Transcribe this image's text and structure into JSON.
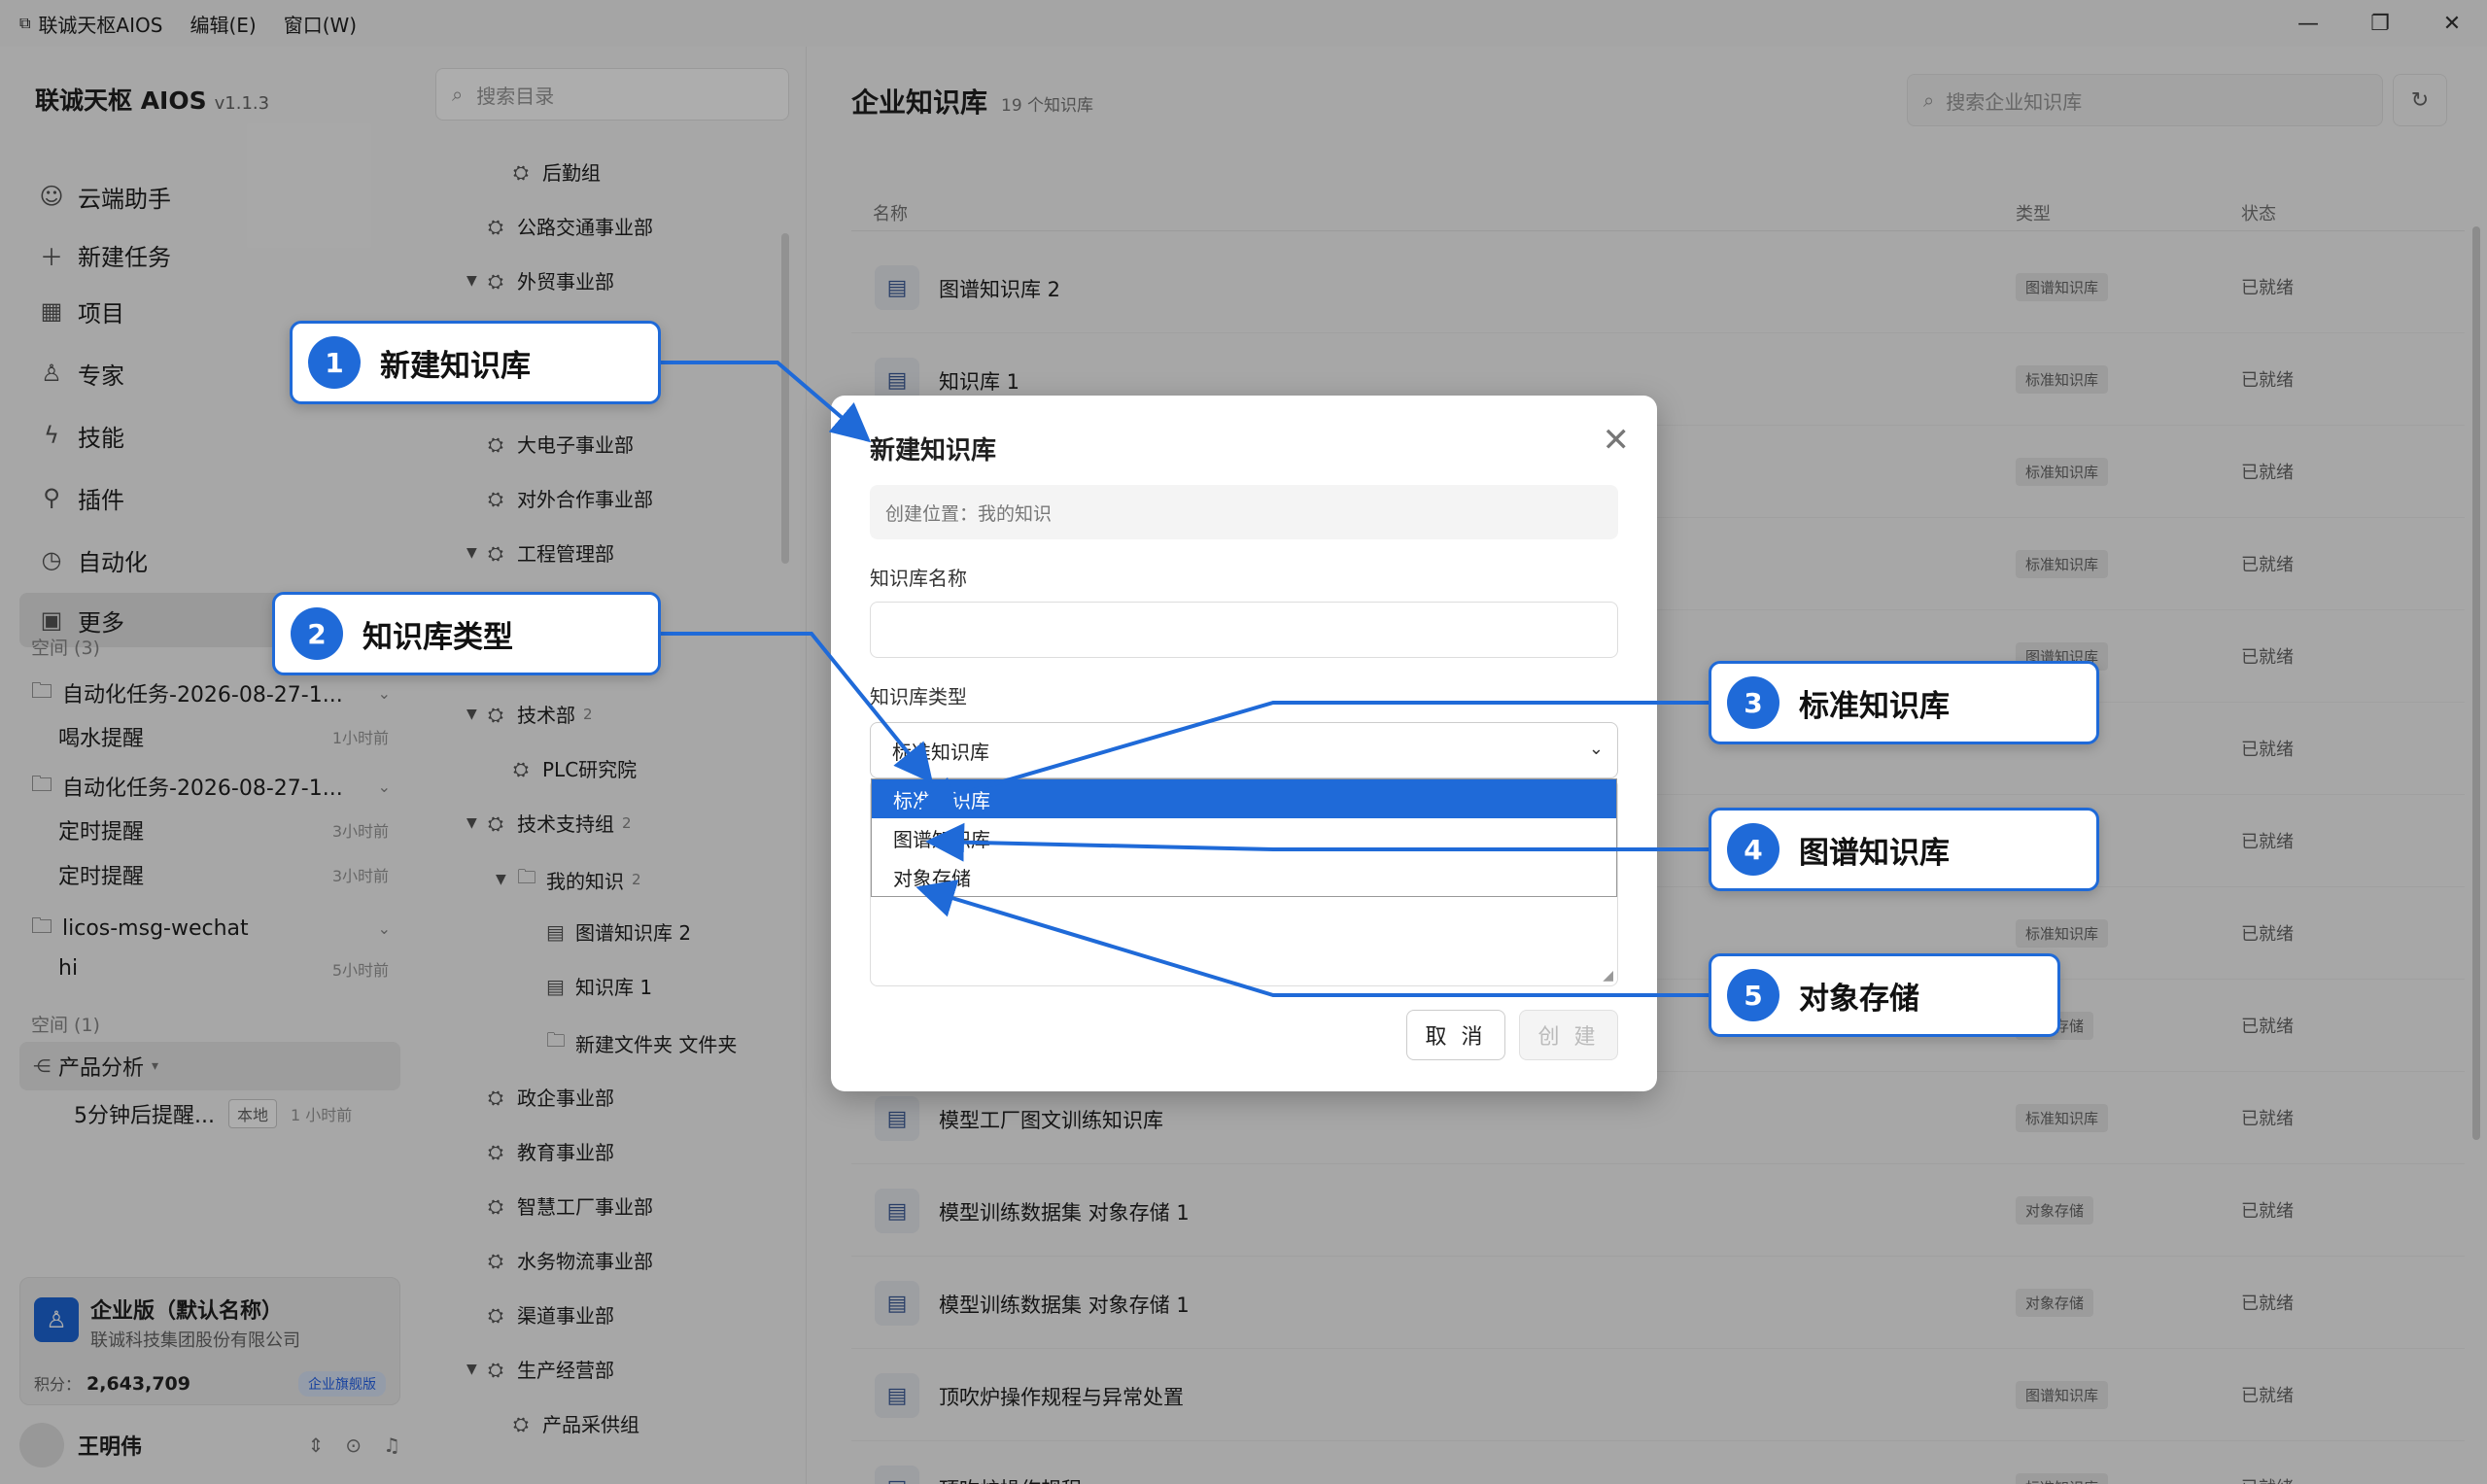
{
  "titlebar": {
    "app_name": "联诚天枢AIOS",
    "menu_edit": "编辑(E)",
    "menu_window": "窗口(W)",
    "minimize": "—",
    "maximize": "❐",
    "close": "✕"
  },
  "sidebar": {
    "brand": "联诚天枢 AIOS",
    "version": "v1.1.3",
    "nav": [
      {
        "label": "云端助手",
        "icon": "chat-icon"
      },
      {
        "label": "新建任务",
        "icon": "plus-icon"
      },
      {
        "label": "项目",
        "icon": "project-icon"
      },
      {
        "label": "专家",
        "icon": "expert-icon"
      },
      {
        "label": "技能",
        "icon": "lightning-icon"
      },
      {
        "label": "插件",
        "icon": "plugin-icon"
      },
      {
        "label": "自动化",
        "icon": "clock-icon"
      },
      {
        "label": "更多",
        "icon": "grid-icon"
      }
    ],
    "space1_label": "空间 (3)",
    "tasks": [
      {
        "label": "自动化任务-2026-08-27-1...",
        "subs": [
          {
            "label": "喝水提醒",
            "time": "1小时前"
          }
        ]
      },
      {
        "label": "自动化任务-2026-08-27-1...",
        "subs": [
          {
            "label": "定时提醒",
            "time": "3小时前"
          },
          {
            "label": "定时提醒",
            "time": "3小时前"
          }
        ]
      },
      {
        "label": "licos-msg-wechat",
        "subs": [
          {
            "label": "hi",
            "time": "5小时前"
          }
        ]
      }
    ],
    "space2_label": "空间 (1)",
    "product": "产品分析",
    "product_sub": {
      "label": "5分钟后提醒...",
      "tag": "本地",
      "time": "1 小时前"
    },
    "enterprise": {
      "name": "企业版（默认名称）",
      "company": "联诚科技集团股份有限公司",
      "points_label": "积分：",
      "points": "2,643,709",
      "badge": "企业旗舰版"
    },
    "user": {
      "name": "王明伟"
    }
  },
  "tree": {
    "search_placeholder": "搜索目录",
    "nodes": [
      {
        "label": "后勤组",
        "arrow": "",
        "icon": "org",
        "count": ""
      },
      {
        "label": "公路交通事业部",
        "arrow": "",
        "icon": "org",
        "count": ""
      },
      {
        "label": "外贸事业部",
        "arrow": "▼",
        "icon": "org",
        "count": ""
      },
      {
        "label": "大电子事业部",
        "arrow": "",
        "icon": "org",
        "count": ""
      },
      {
        "label": "对外合作事业部",
        "arrow": "",
        "icon": "org",
        "count": ""
      },
      {
        "label": "工程管理部",
        "arrow": "▼",
        "icon": "org",
        "count": ""
      },
      {
        "label": "技术部",
        "arrow": "▼",
        "icon": "org",
        "count": "2"
      },
      {
        "label": "PLC研究院",
        "arrow": "",
        "icon": "org",
        "count": ""
      },
      {
        "label": "技术支持组",
        "arrow": "▼",
        "icon": "org",
        "count": "2"
      },
      {
        "label": "我的知识",
        "arrow": "▼",
        "icon": "folder",
        "count": "2"
      },
      {
        "label": "图谱知识库 2",
        "arrow": "",
        "icon": "doc",
        "count": ""
      },
      {
        "label": "知识库 1",
        "arrow": "",
        "icon": "doc",
        "count": ""
      },
      {
        "label": "新建文件夹 文件夹",
        "arrow": "",
        "icon": "folder",
        "count": ""
      },
      {
        "label": "政企事业部",
        "arrow": "",
        "icon": "org",
        "count": ""
      },
      {
        "label": "教育事业部",
        "arrow": "",
        "icon": "org",
        "count": ""
      },
      {
        "label": "智慧工厂事业部",
        "arrow": "",
        "icon": "org",
        "count": ""
      },
      {
        "label": "水务物流事业部",
        "arrow": "",
        "icon": "org",
        "count": ""
      },
      {
        "label": "渠道事业部",
        "arrow": "",
        "icon": "org",
        "count": ""
      },
      {
        "label": "生产经营部",
        "arrow": "▼",
        "icon": "org",
        "count": ""
      },
      {
        "label": "产品采供组",
        "arrow": "",
        "icon": "org",
        "count": ""
      }
    ]
  },
  "main": {
    "title": "企业知识库",
    "count": "19 个知识库",
    "search_placeholder": "搜索企业知识库",
    "columns": {
      "name": "名称",
      "type": "类型",
      "status": "状态"
    },
    "rows": [
      {
        "name": "图谱知识库 2",
        "type": "图谱知识库",
        "status": "已就绪"
      },
      {
        "name": "知识库 1",
        "type": "标准知识库",
        "status": "已就绪"
      },
      {
        "name": "",
        "type": "标准知识库",
        "status": "已就绪"
      },
      {
        "name": "",
        "type": "标准知识库",
        "status": "已就绪"
      },
      {
        "name": "",
        "type": "图谱知识库",
        "status": "已就绪"
      },
      {
        "name": "",
        "type": "",
        "status": "已就绪"
      },
      {
        "name": "",
        "type": "",
        "status": "已就绪"
      },
      {
        "name": "",
        "type": "标准知识库",
        "status": "已就绪"
      },
      {
        "name": "",
        "type": "对象存储",
        "status": "已就绪"
      },
      {
        "name": "模型工厂图文训练知识库",
        "type": "标准知识库",
        "status": "已就绪"
      },
      {
        "name": "模型训练数据集 对象存储 1",
        "type": "对象存储",
        "status": "已就绪"
      },
      {
        "name": "模型训练数据集 对象存储 1",
        "type": "对象存储",
        "status": "已就绪"
      },
      {
        "name": "顶吹炉操作规程与异常处置",
        "type": "图谱知识库",
        "status": "已就绪"
      },
      {
        "name": "顶吹炉操作规程",
        "type": "标准知识库",
        "status": "已就绪"
      }
    ]
  },
  "dialog": {
    "title": "新建知识库",
    "location": "创建位置：我的知识",
    "name_label": "知识库名称",
    "type_label": "知识库类型",
    "type_selected": "标准知识库",
    "options": [
      "标准知识库",
      "图谱知识库",
      "对象存储"
    ],
    "cancel": "取 消",
    "create": "创 建"
  },
  "callouts": [
    {
      "num": "1",
      "text": "新建知识库"
    },
    {
      "num": "2",
      "text": "知识库类型"
    },
    {
      "num": "3",
      "text": "标准知识库"
    },
    {
      "num": "4",
      "text": "图谱知识库"
    },
    {
      "num": "5",
      "text": "对象存储"
    }
  ],
  "colors": {
    "accent": "#1f6ad8"
  }
}
